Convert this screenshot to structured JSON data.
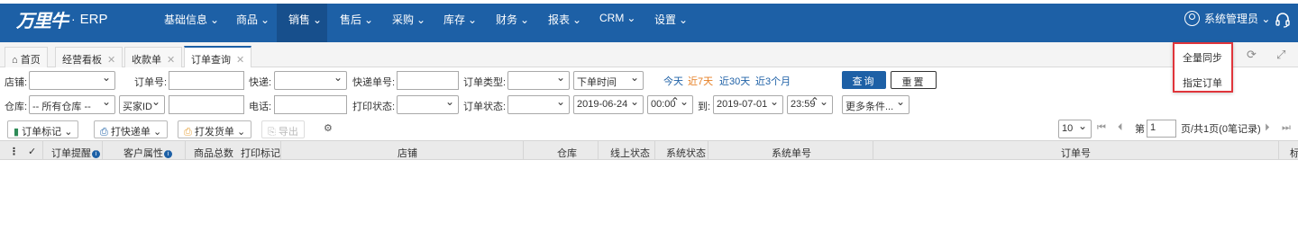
{
  "brand": {
    "logo_text": "万里牛",
    "logo_suffix": "ERP"
  },
  "nav": {
    "items": [
      {
        "label": "基础信息",
        "arrow": "⌄"
      },
      {
        "label": "商品",
        "arrow": "⌄"
      },
      {
        "label": "销售",
        "arrow": "⌄"
      },
      {
        "label": "售后",
        "arrow": "⌄"
      },
      {
        "label": "采购",
        "arrow": "⌄"
      },
      {
        "label": "库存",
        "arrow": "⌄"
      },
      {
        "label": "财务",
        "arrow": "⌄"
      },
      {
        "label": "报表",
        "arrow": "⌄"
      },
      {
        "label": "CRM",
        "arrow": "⌄"
      },
      {
        "label": "设置",
        "arrow": "⌄"
      }
    ],
    "active": "销售",
    "user": "系统管理员 ⌄",
    "colors": {
      "bar": "#1d60a6",
      "active": "#174f8c"
    }
  },
  "tabs": [
    {
      "label": "首页",
      "closable": false
    },
    {
      "label": "经营看板",
      "closable": true
    },
    {
      "label": "收款单",
      "closable": true
    },
    {
      "label": "订单查询",
      "closable": true,
      "active": true
    }
  ],
  "dropdown": {
    "items": [
      "全量同步",
      "指定订单"
    ],
    "border_color": "#e0353b"
  },
  "filters": {
    "row1": {
      "shop_label": "店铺:",
      "order_no_label": "订单号:",
      "express_label": "快递:",
      "tracking_label": "快递单号:",
      "order_type_label": "订单类型:",
      "time_select": "下单时间",
      "quick": [
        "今天",
        "近7天",
        "近30天",
        "近3个月"
      ],
      "search_btn": "查询",
      "reset_btn": "重置"
    },
    "row2": {
      "warehouse_label": "仓库:",
      "warehouse_value": "-- 所有仓库 --",
      "buyer_select": "买家ID",
      "phone_label": "电话:",
      "print_status_label": "打印状态:",
      "order_status_label": "订单状态:",
      "date_from": "2019-06-24",
      "time_from": "00:00",
      "to_label": "到:",
      "date_to": "2019-07-01",
      "time_to": "23:59",
      "more_btn": "更多条件..."
    }
  },
  "toolbar": {
    "order_mark": "订单标记",
    "print_express": "打快递单",
    "print_delivery": "打发货单",
    "export": "导出"
  },
  "pager": {
    "page_size": "10",
    "page_label": "第",
    "page_num": "1",
    "page_total": "页/共1页(0笔记录)"
  },
  "grid": {
    "columns": [
      "订单提醒",
      "客户属性",
      "商品总数",
      "打印标记",
      "店铺",
      "仓库",
      "线上状态",
      "系统状态",
      "系统单号",
      "订单号",
      "标"
    ]
  }
}
